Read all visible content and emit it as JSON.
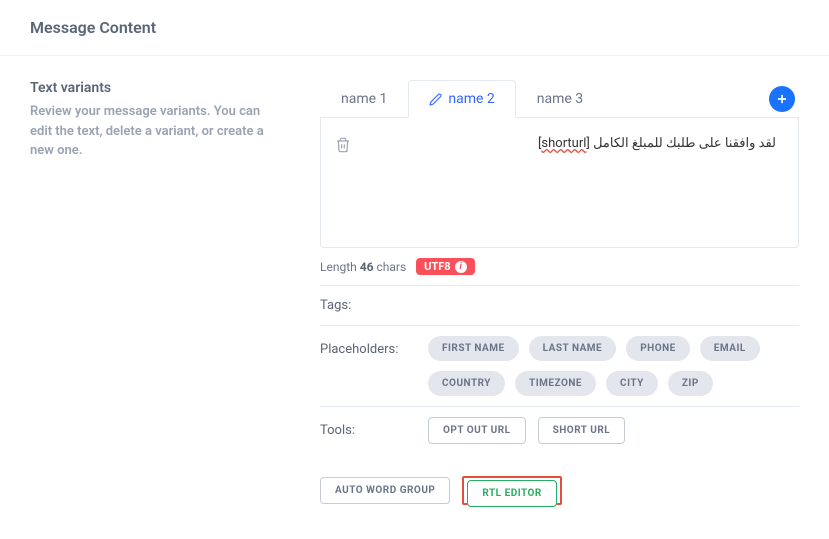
{
  "header": {
    "title": "Message Content"
  },
  "sidebar": {
    "title": "Text variants",
    "desc": "Review your message variants. You can edit the text, delete a variant, or create a new one."
  },
  "tabs": [
    {
      "label": "name 1",
      "active": false
    },
    {
      "label": "name 2",
      "active": true
    },
    {
      "label": "name 3",
      "active": false
    }
  ],
  "editor": {
    "content": "لقد وافقنا على طلبك للمبلغ الكامل [shorturl]",
    "part1": "لقد وافقنا على طلبك للمبلغ الكامل [",
    "underlined": "shorturl",
    "part2": "]"
  },
  "meta": {
    "length_prefix": "Length",
    "length_value": "46",
    "length_suffix": "chars",
    "encoding": "UTF8"
  },
  "tags_label": "Tags:",
  "placeholders": {
    "label": "Placeholders:",
    "items": [
      "FIRST NAME",
      "LAST NAME",
      "PHONE",
      "EMAIL",
      "COUNTRY",
      "TIMEZONE",
      "CITY",
      "ZIP"
    ]
  },
  "tools": {
    "label": "Tools:",
    "items": [
      {
        "label": "OPT OUT URL",
        "style": "normal"
      },
      {
        "label": "SHORT URL",
        "style": "normal"
      },
      {
        "label": "AUTO WORD GROUP",
        "style": "normal"
      },
      {
        "label": "RTL EDITOR",
        "style": "highlight"
      }
    ]
  }
}
